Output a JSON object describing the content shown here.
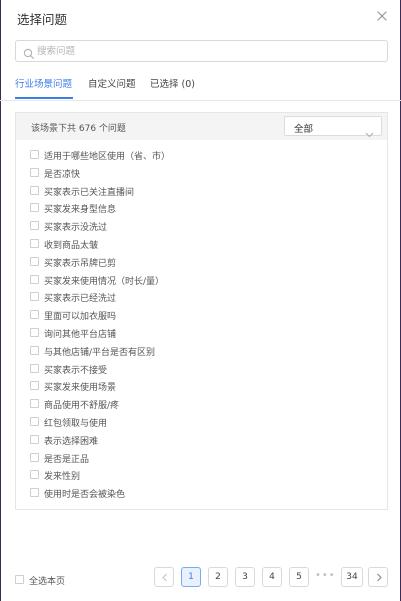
{
  "dialog": {
    "title": "选择问题"
  },
  "search": {
    "placeholder": "搜索问题"
  },
  "tabs": [
    {
      "label": "行业场景问题",
      "active": true
    },
    {
      "label": "自定义问题",
      "active": false
    },
    {
      "label": "已选择 (0)",
      "active": false
    }
  ],
  "panel": {
    "count_text": "该场景下共 676 个问题",
    "filter_value": "全部"
  },
  "questions": [
    "适用于哪些地区使用（省、市）",
    "是否凉快",
    "买家表示已关注直播间",
    "买家发来身型信息",
    "买家表示没洗过",
    "收到商品太皱",
    "买家表示吊牌已剪",
    "买家发来使用情况（时长/量）",
    "买家表示已经洗过",
    "里面可以加衣服吗",
    "询问其他平台店铺",
    "与其他店铺/平台是否有区别",
    "买家表示不接受",
    "买家发来使用场景",
    "商品使用不舒服/疼",
    "红包领取与使用",
    "表示选择困难",
    "是否是正品",
    "发来性别",
    "使用时是否会被染色"
  ],
  "footer": {
    "select_all_label": "全选本页"
  },
  "pagination": {
    "current": 1,
    "pages": [
      "1",
      "2",
      "3",
      "4",
      "5"
    ],
    "ellipsis": "•••",
    "last": "34"
  },
  "colors": {
    "accent": "#3b7de9",
    "panel_header_bg": "#f4f4f4"
  },
  "icons": {
    "close": "close-icon",
    "search": "search-icon",
    "dropdown": "chevron-down-icon",
    "prev": "chevron-left-icon",
    "next": "chevron-right-icon"
  }
}
